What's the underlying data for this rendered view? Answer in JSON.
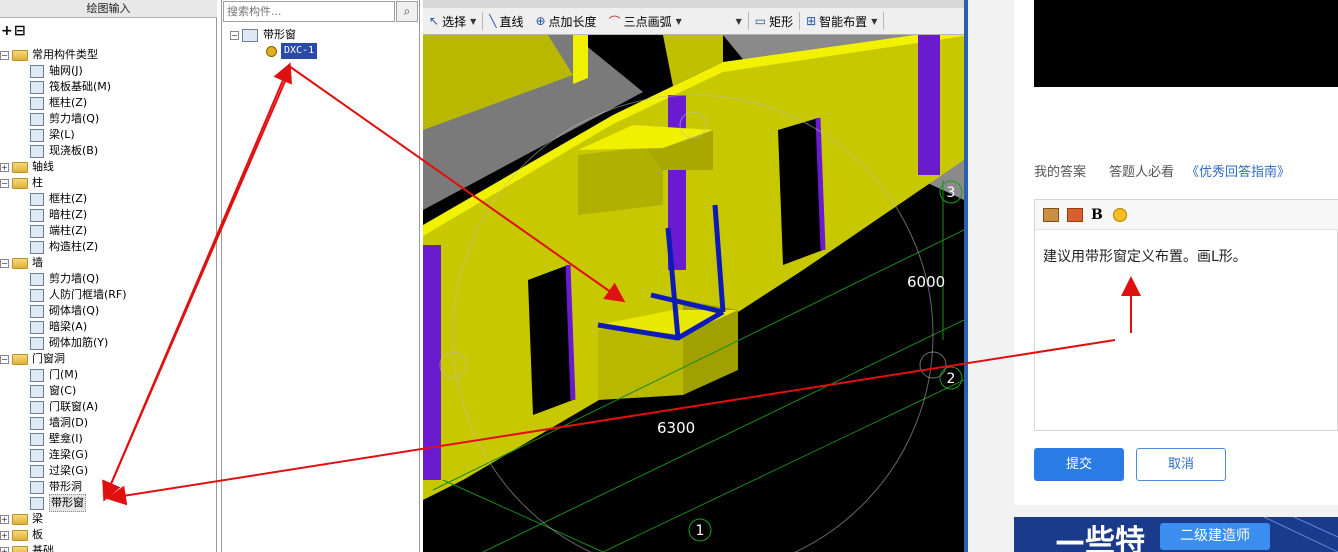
{
  "left_panel": {
    "title": "绘图输入",
    "tree": [
      {
        "label": "常用构件类型",
        "level": 0,
        "kind": "folder",
        "expander": "−"
      },
      {
        "label": "轴网(J)",
        "level": 1,
        "kind": "item",
        "icon": "grid-icon"
      },
      {
        "label": "筏板基础(M)",
        "level": 1,
        "kind": "item",
        "icon": "raft-foundation-icon"
      },
      {
        "label": "框柱(Z)",
        "level": 1,
        "kind": "item",
        "icon": "column-icon"
      },
      {
        "label": "剪力墙(Q)",
        "level": 1,
        "kind": "item",
        "icon": "shear-wall-icon"
      },
      {
        "label": "梁(L)",
        "level": 1,
        "kind": "item",
        "icon": "beam-icon"
      },
      {
        "label": "现浇板(B)",
        "level": 1,
        "kind": "item",
        "icon": "slab-icon"
      },
      {
        "label": "轴线",
        "level": 0,
        "kind": "folder",
        "expander": "+"
      },
      {
        "label": "柱",
        "level": 0,
        "kind": "folder",
        "expander": "−"
      },
      {
        "label": "框柱(Z)",
        "level": 1,
        "kind": "item",
        "icon": "column-icon"
      },
      {
        "label": "暗柱(Z)",
        "level": 1,
        "kind": "item",
        "icon": "hidden-column-icon"
      },
      {
        "label": "端柱(Z)",
        "level": 1,
        "kind": "item",
        "icon": "end-column-icon"
      },
      {
        "label": "构造柱(Z)",
        "level": 1,
        "kind": "item",
        "icon": "structural-column-icon"
      },
      {
        "label": "墙",
        "level": 0,
        "kind": "folder",
        "expander": "−"
      },
      {
        "label": "剪力墙(Q)",
        "level": 1,
        "kind": "item",
        "icon": "shear-wall-icon"
      },
      {
        "label": "人防门框墙(RF)",
        "level": 1,
        "kind": "item",
        "icon": "civil-defense-door-wall-icon"
      },
      {
        "label": "砌体墙(Q)",
        "level": 1,
        "kind": "item",
        "icon": "masonry-wall-icon"
      },
      {
        "label": "暗梁(A)",
        "level": 1,
        "kind": "item",
        "icon": "hidden-beam-icon"
      },
      {
        "label": "砌体加筋(Y)",
        "level": 1,
        "kind": "item",
        "icon": "masonry-rebar-icon"
      },
      {
        "label": "门窗洞",
        "level": 0,
        "kind": "folder",
        "expander": "−"
      },
      {
        "label": "门(M)",
        "level": 1,
        "kind": "item",
        "icon": "door-icon"
      },
      {
        "label": "窗(C)",
        "level": 1,
        "kind": "item",
        "icon": "window-icon"
      },
      {
        "label": "门联窗(A)",
        "level": 1,
        "kind": "item",
        "icon": "door-window-icon"
      },
      {
        "label": "墙洞(D)",
        "level": 1,
        "kind": "item",
        "icon": "wall-opening-icon"
      },
      {
        "label": "壁龛(I)",
        "level": 1,
        "kind": "item",
        "icon": "niche-icon"
      },
      {
        "label": "连梁(G)",
        "level": 1,
        "kind": "item",
        "icon": "coupling-beam-icon"
      },
      {
        "label": "过梁(G)",
        "level": 1,
        "kind": "item",
        "icon": "lintel-icon"
      },
      {
        "label": "带形洞",
        "level": 1,
        "kind": "item",
        "icon": "strip-opening-icon"
      },
      {
        "label": "带形窗",
        "level": 1,
        "kind": "item",
        "icon": "strip-window-icon",
        "selected": true
      },
      {
        "label": "梁",
        "level": 0,
        "kind": "folder",
        "expander": "+"
      },
      {
        "label": "板",
        "level": 0,
        "kind": "folder",
        "expander": "+"
      },
      {
        "label": "基础",
        "level": 0,
        "kind": "folder",
        "expander": "+"
      }
    ]
  },
  "middle_panel": {
    "search_placeholder": "搜索构件...",
    "search_icon": "search-icon",
    "root_label": "带形窗",
    "root_expander": "−",
    "child_label": "DXC-1"
  },
  "toolbar": {
    "select": "选择",
    "line": "直线",
    "add_length": "点加长度",
    "arc": "三点画弧",
    "rect": "矩形",
    "smart_place": "智能布置"
  },
  "viewport": {
    "dim_top": "6000",
    "dim_bottom": "6300",
    "axis_1": "1",
    "axis_2": "2",
    "axis_3": "3",
    "colors": {
      "wall": "#d4d400",
      "wall_edge": "#f0f000",
      "column": "#6a1bd0",
      "strip_window": "#0d1ab8",
      "grid": "#1a8a1a",
      "annotation": "#e01010"
    }
  },
  "answer": {
    "tab_my_answer": "我的答案",
    "tab_must_read": "答题人必看",
    "tab_guide": "《优秀回答指南》",
    "bold_label": "B",
    "editor_text": "建议用带形窗定义布置。画L形。",
    "submit": "提交",
    "cancel": "取消"
  },
  "banner": {
    "badge": "二级建造师",
    "big_text": "—些特"
  }
}
